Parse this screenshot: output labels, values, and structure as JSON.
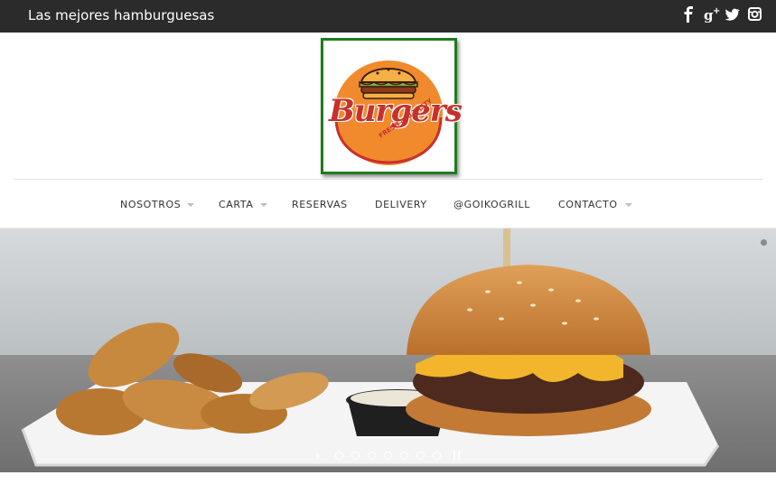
{
  "topbar": {
    "tagline": "Las mejores hamburguesas",
    "social": [
      {
        "icon": "facebook-icon",
        "glyph": "f"
      },
      {
        "icon": "google-plus-icon",
        "glyph": "g+"
      },
      {
        "icon": "twitter-icon",
        "glyph": "t"
      },
      {
        "icon": "instagram-icon",
        "glyph": "ig"
      }
    ]
  },
  "logo": {
    "word": "Burgers",
    "tagline": "FRESH and TASTY"
  },
  "nav": {
    "items": [
      {
        "label": "NOSOTROS",
        "has_submenu": true
      },
      {
        "label": "CARTA",
        "has_submenu": true
      },
      {
        "label": "RESERVAS",
        "has_submenu": false
      },
      {
        "label": "DELIVERY",
        "has_submenu": false
      },
      {
        "label": "@GOIKOGRILL",
        "has_submenu": false
      },
      {
        "label": "CONTACTO",
        "has_submenu": true
      }
    ]
  },
  "slider": {
    "slide_count": 7,
    "active_slide": 1,
    "controls": {
      "next": "›",
      "pause": "pause-icon"
    }
  },
  "colors": {
    "topbar": "#2b2b2b",
    "logo_border": "#1e7c1e",
    "logo_orange": "#f08a2c",
    "logo_red": "#c9302c"
  }
}
